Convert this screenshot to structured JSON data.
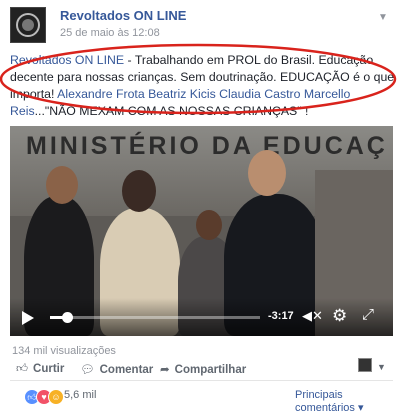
{
  "header": {
    "page_name": "Revoltados ON LINE",
    "date": "25 de maio às 12:08"
  },
  "post": {
    "author_link": "Revoltados ON LINE",
    "text_1": " - Trabalhando em PROL do Brasil. Educação decente para nossas crianças. Sem doutrinação. EDUCAÇÃO é o que importa!",
    "tagged": "Alexandre Frota Beatriz Kicis Claudia Castro Marcello Reis",
    "text_2": "...\"NÃO MEXAM COM AS NOSSAS CRIANÇAS\" !",
    "highlight_color": "#d9231c"
  },
  "video": {
    "sign_text": "MINISTÉRIO DA EDUCAÇ",
    "time_remaining": "-3:17",
    "progress": 0.08
  },
  "footer": {
    "views": "134 mil visualizações",
    "like_label": "Curtir",
    "comment_label": "Comentar",
    "share_label": "Compartilhar",
    "reaction_count": "5,6 mil",
    "comments_sort_label": "Principais comentários"
  },
  "colors": {
    "link": "#365899",
    "like_blue": "#5890ff",
    "love_red": "#f25268",
    "haha_yellow": "#f7b125"
  }
}
